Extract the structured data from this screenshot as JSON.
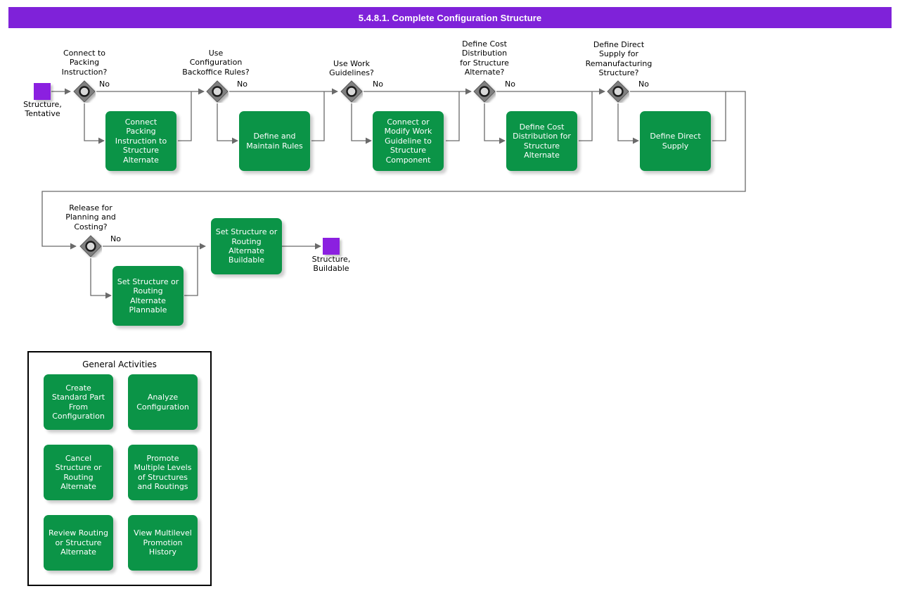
{
  "header": {
    "title": "5.4.8.1. Complete Configuration Structure",
    "bg_color": "#7f22d9",
    "text_color": "#ffffff"
  },
  "palette": {
    "activity_green": "#0b9447",
    "terminator_purple": "#8b20e0",
    "decision_gray": "#808080",
    "line_gray": "#666666",
    "text_white": "#ffffff",
    "text_black": "#000000"
  },
  "flow": {
    "start_terminator": {
      "label": "Structure,\nTentative"
    },
    "end_terminator": {
      "label": "Structure,\nBuildable"
    },
    "no_label": "No",
    "stages": [
      {
        "id": "connect-packing-instruction",
        "decision": "Connect to\nPacking\nInstruction?",
        "activity": "Connect Packing\nInstruction to\nStructure\nAlternate",
        "branch_label": "No"
      },
      {
        "id": "configuration-backoffice-rules",
        "decision": "Use\nConfiguration\nBackoffice Rules?",
        "activity": "Define and\nMaintain Rules",
        "branch_label": "No"
      },
      {
        "id": "work-guidelines",
        "decision": "Use Work\nGuidelines?",
        "activity": "Connect or\nModify Work\nGuideline to\nStructure\nComponent",
        "branch_label": "No"
      },
      {
        "id": "cost-distribution",
        "decision": "Define Cost\nDistribution\nfor Structure\nAlternate?",
        "activity": "Define Cost\nDistribution for\nStructure\nAlternate",
        "branch_label": "No"
      },
      {
        "id": "direct-supply",
        "decision": "Define Direct\nSupply for\nRemanufacturing\nStructure?",
        "activity": "Define Direct\nSupply",
        "branch_label": "No"
      },
      {
        "id": "release-planning-costing",
        "decision": "Release for\nPlanning and\nCosting?",
        "activity": "Set Structure or\nRouting\nAlternate\nPlannable",
        "branch_label": "No"
      }
    ],
    "final_activity": "Set Structure or\nRouting\nAlternate\nBuildable"
  },
  "general_activities": {
    "title": "General Activities",
    "items": [
      "Create Standard\nPart From\nConfiguration",
      "Analyze\nConfiguration",
      "Cancel Structure\nor Routing\nAlternate",
      "Promote Multiple\nLevels of\nStructures and\nRoutings",
      "Review Routing\nor Structure\nAlternate",
      "View Multilevel\nPromotion\nHistory"
    ]
  }
}
